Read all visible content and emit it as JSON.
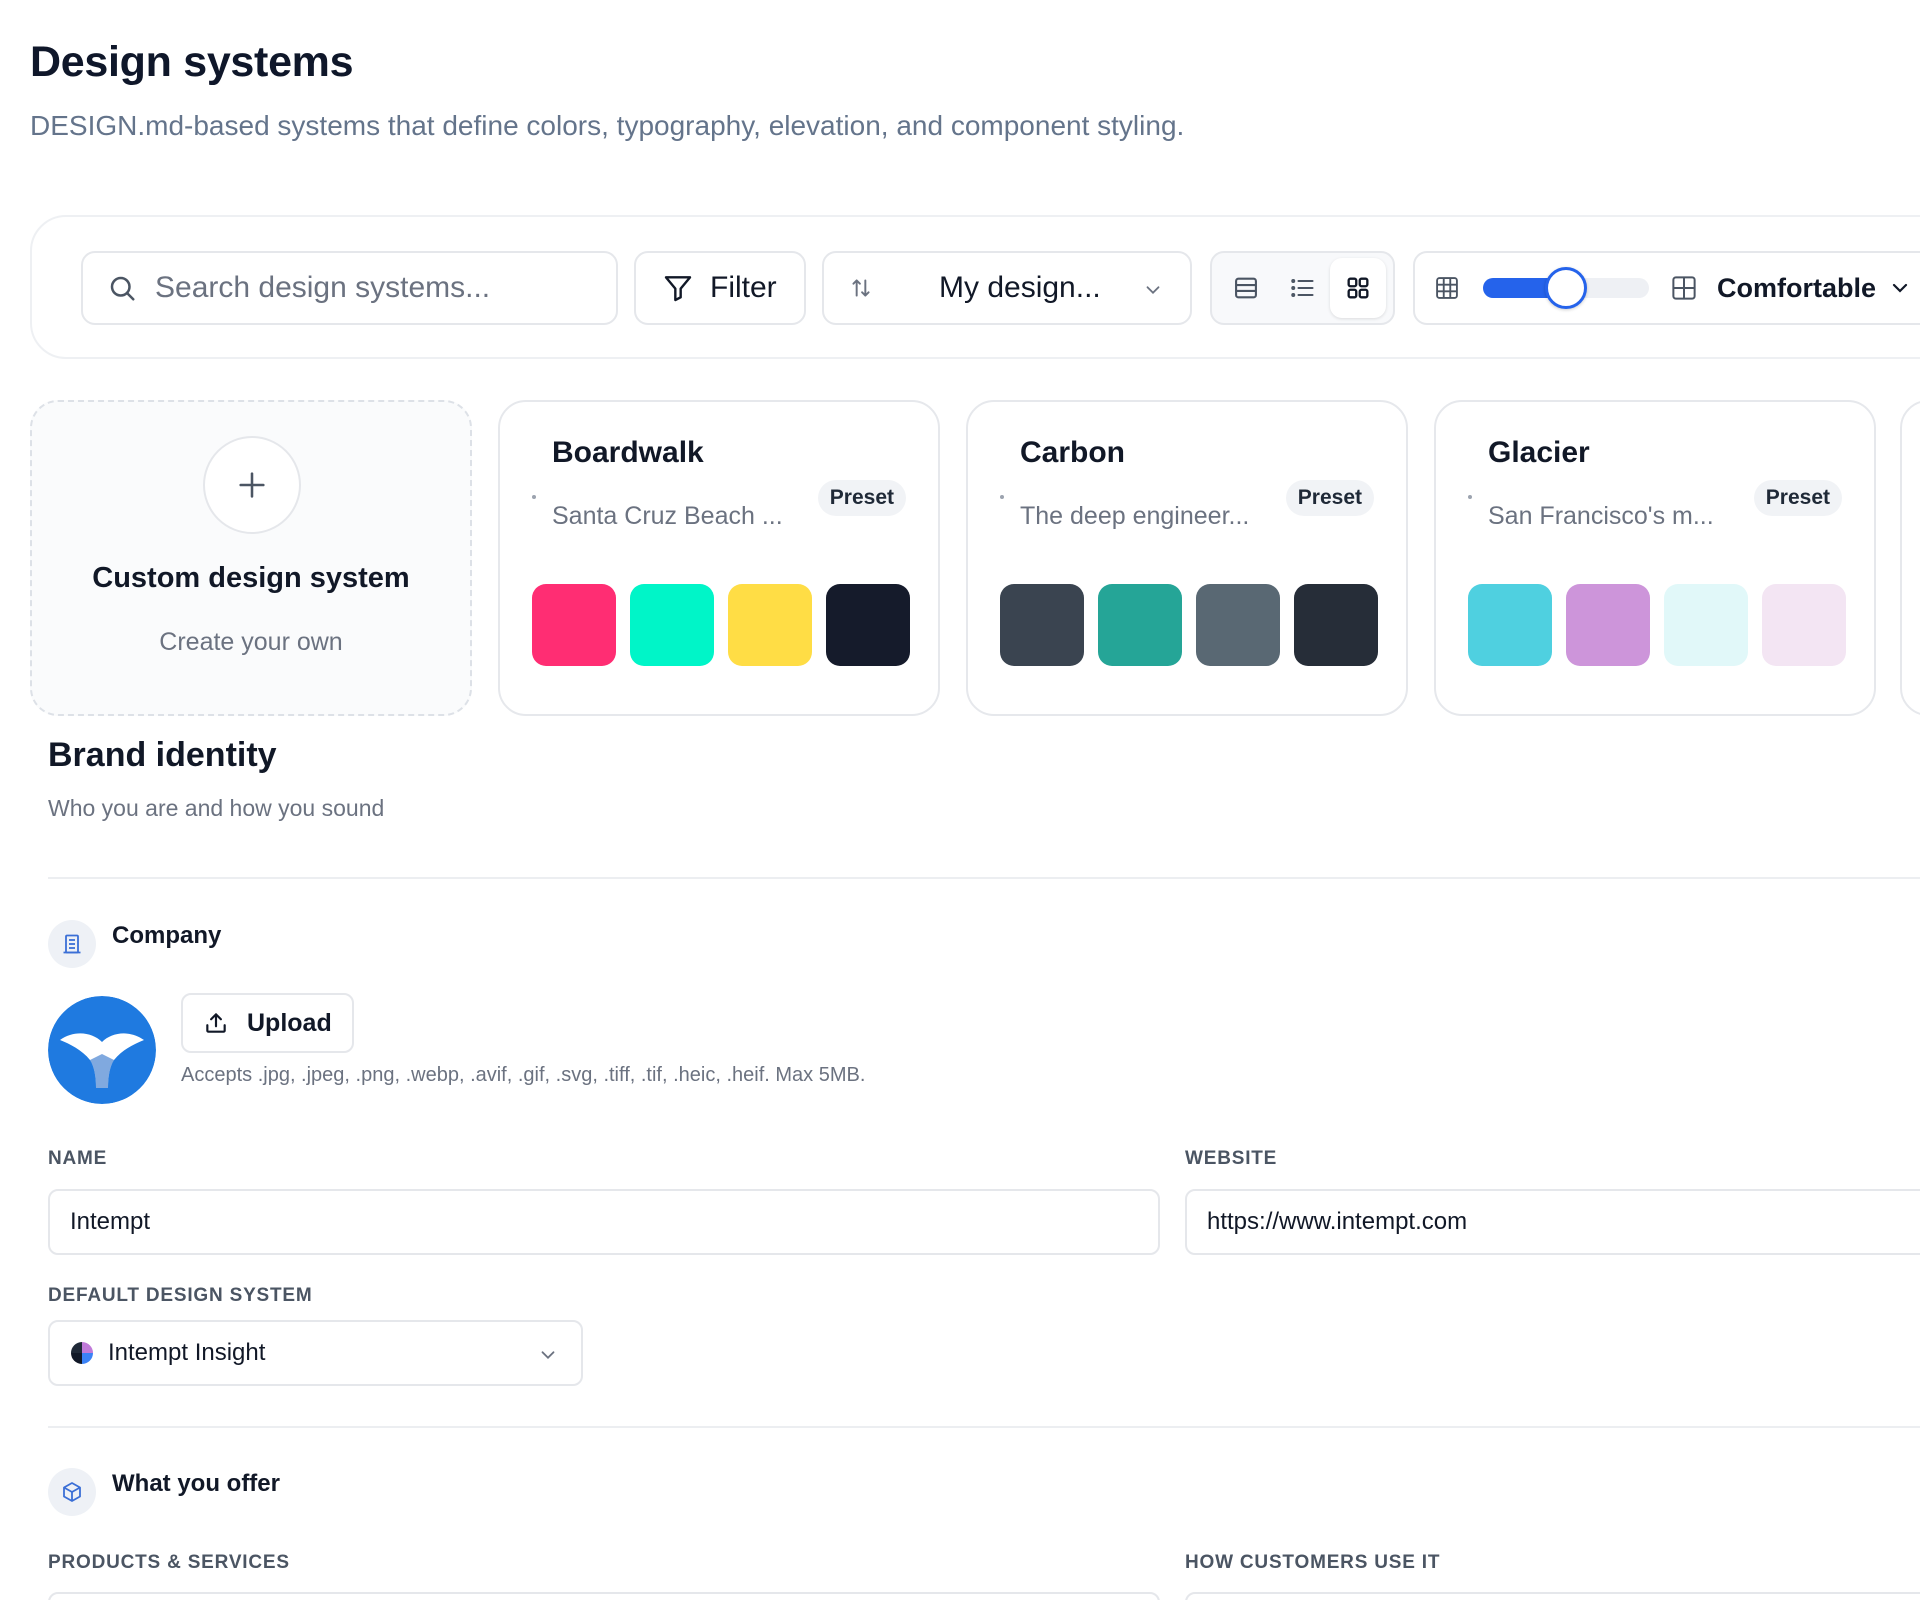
{
  "header": {
    "title": "Design systems",
    "subtitle": "DESIGN.md-based systems that define colors, typography, elevation, and component styling."
  },
  "toolbar": {
    "search_placeholder": "Search design systems...",
    "filter_label": "Filter",
    "sort_value": "My design...",
    "view_modes": [
      "table-view",
      "list-view",
      "grid-view"
    ],
    "active_view": "grid-view",
    "density_slider_fraction": 0.5,
    "density_label": "Comfortable"
  },
  "custom_card": {
    "title": "Custom design system",
    "subtitle": "Create your own"
  },
  "cards": [
    {
      "name": "Boardwalk",
      "description": "Santa Cruz Beach ...",
      "badge": "Preset",
      "colors": [
        "#ff2d73",
        "#00f5c8",
        "#ffdd45",
        "#151b2b"
      ]
    },
    {
      "name": "Carbon",
      "description": "The deep engineer...",
      "badge": "Preset",
      "colors": [
        "#3a4450",
        "#25a597",
        "#596873",
        "#262d38"
      ]
    },
    {
      "name": "Glacier",
      "description": "San Francisco's m...",
      "badge": "Preset",
      "colors": [
        "#4fd0e0",
        "#cd95da",
        "#e1f8f9",
        "#f3e5f3"
      ]
    }
  ],
  "brand": {
    "title": "Brand identity",
    "subtitle": "Who you are and how you sound",
    "company": {
      "title": "Company",
      "upload_label": "Upload",
      "upload_hint": "Accepts .jpg, .jpeg, .png, .webp, .avif, .gif, .svg, .tiff, .tif, .heic, .heif. Max 5MB.",
      "name_label": "NAME",
      "name_value": "Intempt",
      "website_label": "WEBSITE",
      "website_value": "https://www.intempt.com",
      "default_ds_label": "DEFAULT DESIGN SYSTEM",
      "default_ds_value": "Intempt Insight"
    },
    "offer": {
      "title": "What you offer",
      "products_label": "PRODUCTS & SERVICES",
      "usage_label": "HOW CUSTOMERS USE IT"
    }
  },
  "colors": {
    "accent": "#2563eb",
    "logo_blue": "#1f7ae0"
  }
}
